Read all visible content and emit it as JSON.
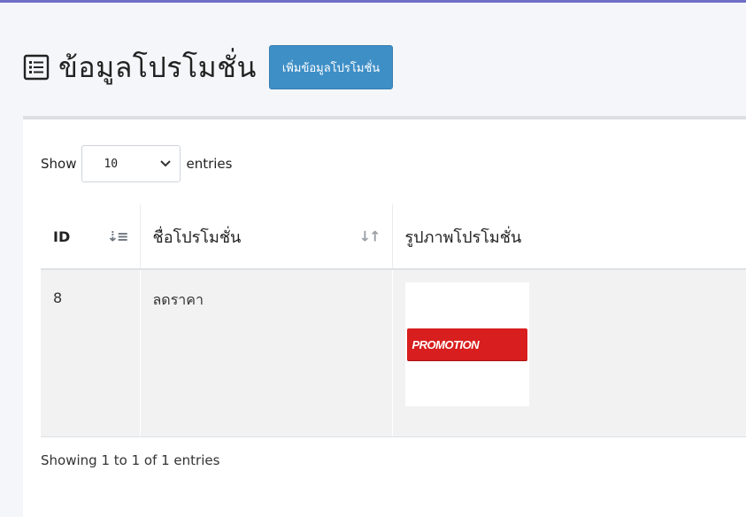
{
  "header": {
    "title": "ข้อมูลโปรโมชั่น",
    "add_button_label": "เพิ่มข้อมูลโปรโมชั่น",
    "title_icon": "list-icon"
  },
  "table_controls": {
    "show_label": "Show",
    "page_length": "10",
    "entries_label": "entries"
  },
  "table": {
    "columns": [
      {
        "label": "ID",
        "sort_icon": "sort-descending-icon"
      },
      {
        "label": "ชื่อโปรโมชั่น",
        "sort_icon": "sort-both-icon"
      },
      {
        "label": "รูปภาพโปรโมชั่น"
      }
    ],
    "rows": [
      {
        "id": "8",
        "name": "ลดราคา",
        "image_text": "PROMOTION"
      }
    ]
  },
  "footer": {
    "info": "Showing 1 to 1 of 1 entries"
  },
  "colors": {
    "accent": "#3f8fc7",
    "promo_red": "#d81e1e",
    "top_rule": "#6f6fc7"
  }
}
